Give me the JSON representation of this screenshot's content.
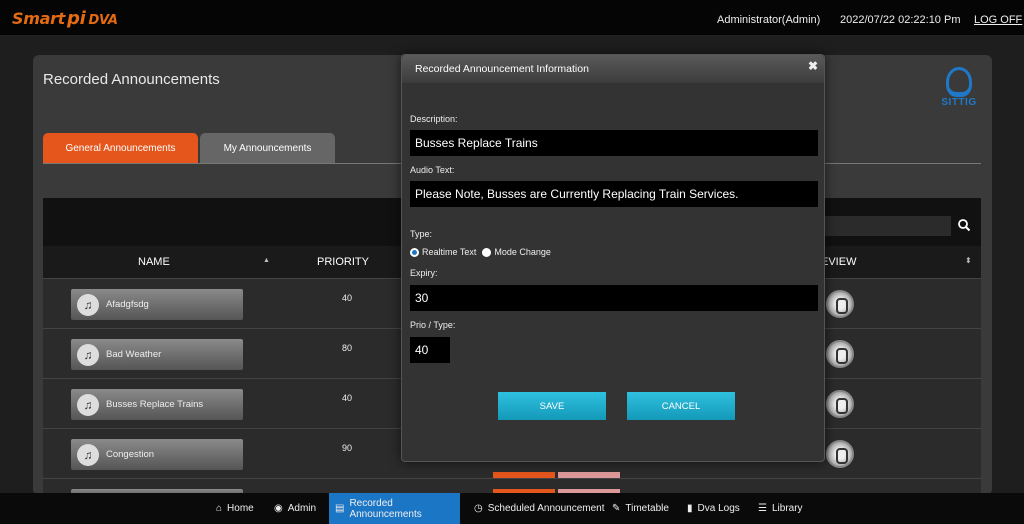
{
  "topbar": {
    "logo_smart": "Smart",
    "logo_pi": "pi",
    "logo_dva": "DVA",
    "user": "Administrator(Admin)",
    "datetime": "2022/07/22 02:22:10 Pm",
    "logoff": "LOG OFF"
  },
  "page": {
    "title": "Recorded Announcements",
    "brand": "SITTIG"
  },
  "tabs": [
    {
      "label": "General Announcements",
      "active": true
    },
    {
      "label": "My Announcements",
      "active": false
    }
  ],
  "table": {
    "columns": {
      "name": "NAME",
      "priority": "PRIORITY",
      "review": "EVIEW"
    },
    "rows": [
      {
        "name": "Afadgfsdg",
        "priority": "40"
      },
      {
        "name": "Bad Weather",
        "priority": "80"
      },
      {
        "name": "Busses Replace Trains",
        "priority": "40"
      },
      {
        "name": "Congestion",
        "priority": "90"
      }
    ]
  },
  "modal": {
    "title": "Recorded Announcement Information",
    "close_icon": "close-icon",
    "description_label": "Description:",
    "description_value": "Busses Replace Trains",
    "audio_label": "Audio Text:",
    "audio_value": "Please Note, Busses are Currently Replacing Train Services.",
    "type_label": "Type:",
    "type_options": [
      "Realtime Text",
      "Mode Change"
    ],
    "type_selected": "Realtime Text",
    "expiry_label": "Expiry:",
    "expiry_value": "30",
    "prio_label": "Prio / Type:",
    "prio_value": "40",
    "save_label": "SAVE",
    "cancel_label": "CANCEL"
  },
  "bottom_nav": [
    {
      "label": "Home",
      "icon": "home-icon",
      "active": false
    },
    {
      "label": "Admin",
      "icon": "eye-icon",
      "active": false
    },
    {
      "label": "Recorded Announcements",
      "icon": "file-audio-icon",
      "active": true
    },
    {
      "label": "Scheduled Announcement",
      "icon": "clock-icon",
      "active": false
    },
    {
      "label": "Timetable",
      "icon": "edit-icon",
      "active": false
    },
    {
      "label": "Dva Logs",
      "icon": "document-icon",
      "active": false
    },
    {
      "label": "Library",
      "icon": "list-icon",
      "active": false
    }
  ],
  "colors": {
    "accent_orange": "#e4561c",
    "accent_blue": "#1c76c6",
    "button_cyan": "#2fc1e0"
  }
}
